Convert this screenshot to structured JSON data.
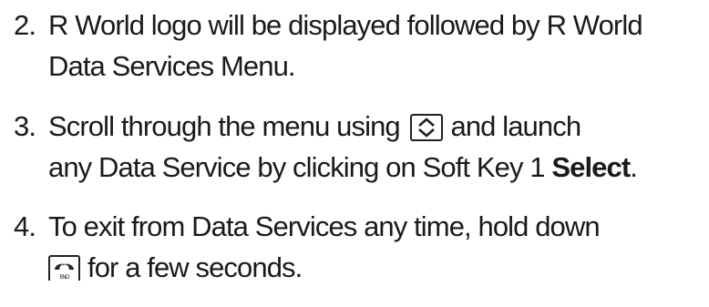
{
  "steps": [
    {
      "number": "2.",
      "line1": "R World logo will be displayed followed by R World",
      "line2": "Data Services Menu."
    },
    {
      "number": "3.",
      "line1_before_icon": "Scroll through the menu using",
      "line1_after_icon": "and launch",
      "line2_before_bold": "any Data Service by clicking on Soft Key 1",
      "line2_bold": "Select",
      "line2_after_bold": "."
    },
    {
      "number": "4.",
      "line1": "To exit from Data Services any time, hold down",
      "line2_after_icon": "for a few seconds.",
      "end_key_label": "END"
    }
  ],
  "icons": {
    "scroll_key": "up-down-arrow-key-icon",
    "end_key": "end-call-key-icon"
  }
}
